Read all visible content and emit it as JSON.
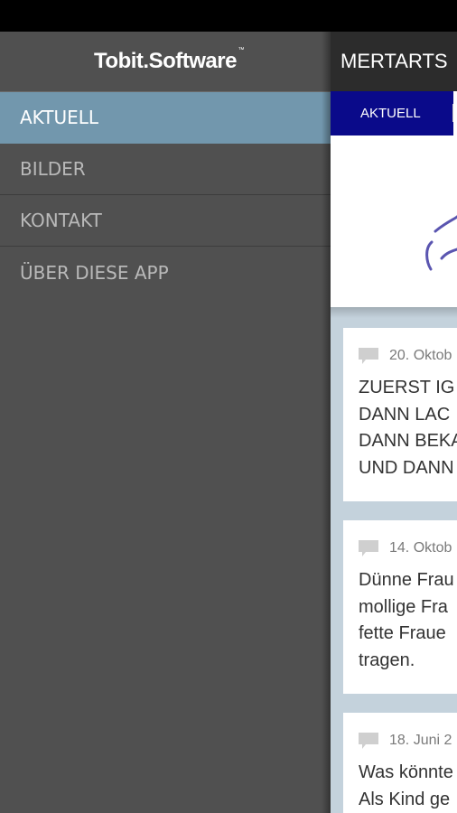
{
  "drawer": {
    "logo_text": "Tobit.Software",
    "logo_tm": "™",
    "items": [
      {
        "label": "AKTUELL",
        "active": true
      },
      {
        "label": "BILDER",
        "active": false
      },
      {
        "label": "KONTAKT",
        "active": false
      },
      {
        "label": "ÜBER DIESE APP",
        "active": false
      }
    ]
  },
  "main": {
    "title": "MERTARTS",
    "tabs": [
      {
        "label": "AKTUELL"
      }
    ],
    "cards": [
      {
        "date": "20. Oktob",
        "text": "ZUERST IG\nDANN LAC\nDANN BEKA\nUND DANN"
      },
      {
        "date": "14. Oktob",
        "text": "Dünne Frau\nmollige Fra\nfette Fraue\ntragen."
      },
      {
        "date": "18. Juni 2",
        "text": "Was könnte\nAls Kind ge"
      }
    ]
  },
  "colors": {
    "drawer_bg": "#505050",
    "active_item": "#7297ad",
    "tab_bar": "#0a0a8a",
    "content_bg": "#c4d2dc"
  }
}
